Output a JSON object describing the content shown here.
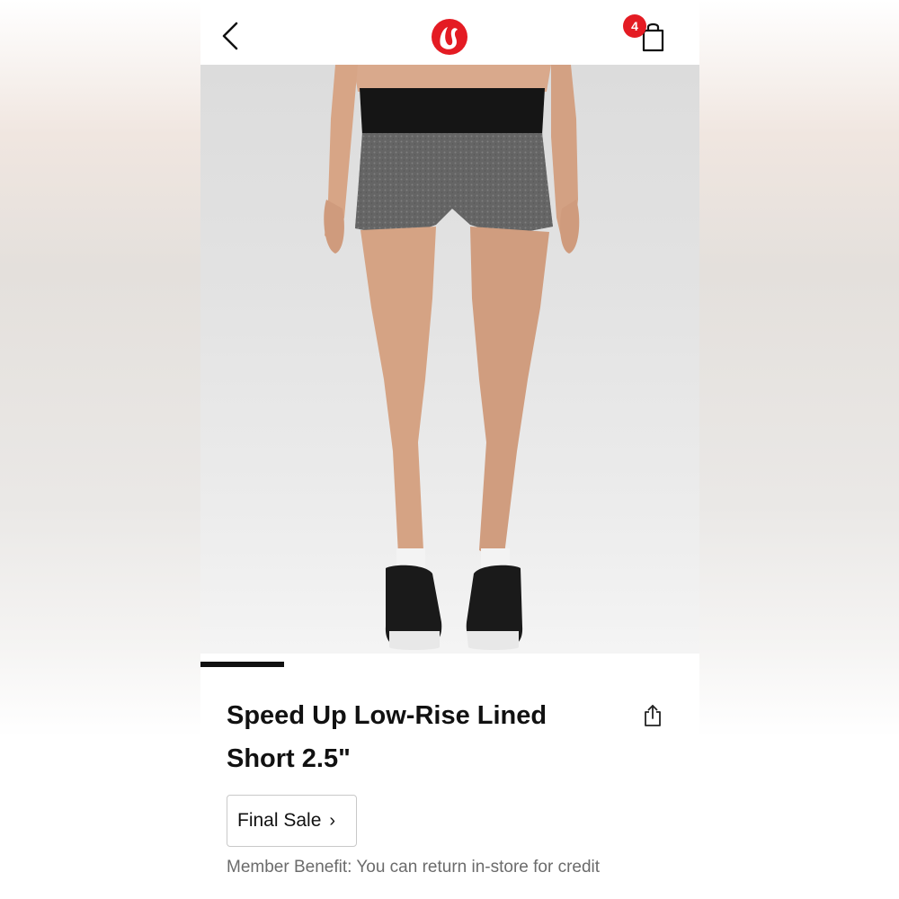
{
  "header": {
    "back_icon": "chevron-left-icon",
    "logo_icon": "lululemon-logo",
    "bag_icon": "shopping-bag-icon",
    "bag_count": "4",
    "accent_color": "#e41b23"
  },
  "hero": {
    "carousel_active_index": 1
  },
  "product": {
    "title_line1": "Speed Up Low-Rise Lined",
    "title_line2": "Short 2.5\"",
    "share_icon": "share-icon",
    "final_sale_label": "Final Sale",
    "final_sale_chevron": "›",
    "member_benefit": "Member Benefit: You can return in-store for credit"
  }
}
